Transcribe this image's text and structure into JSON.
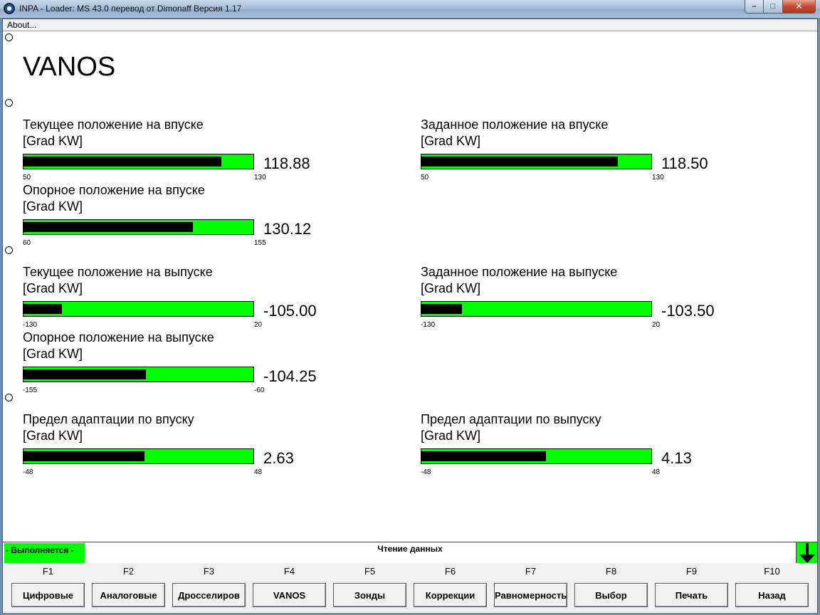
{
  "window": {
    "title": "INPA - Loader:  MS 43.0 перевод от Dimonaff Версия 1.17",
    "controls": {
      "minimize": "–",
      "maximize": "□",
      "close": "✕"
    }
  },
  "menu": {
    "about": "About..."
  },
  "screen": {
    "heading": "VANOS"
  },
  "gauges": [
    {
      "title": "Текущее положение на впуске",
      "unit": "[Grad KW]",
      "min": "50",
      "max": "130",
      "value": "118.88",
      "level": 0.861
    },
    {
      "title": "Заданное положение на впуске",
      "unit": "[Grad KW]",
      "min": "50",
      "max": "130",
      "value": "118.50",
      "level": 0.856
    },
    {
      "title": "Опорное положение на впуске",
      "unit": "[Grad KW]",
      "min": "60",
      "max": "155",
      "value": "130.12",
      "level": 0.738
    },
    {
      "title": "Текущее положение на выпуске",
      "unit": "[Grad KW]",
      "min": "-130",
      "max": "20",
      "value": "-105.00",
      "level": 0.167
    },
    {
      "title": "Заданное положение на выпуске",
      "unit": "[Grad KW]",
      "min": "-130",
      "max": "20",
      "value": "-103.50",
      "level": 0.177
    },
    {
      "title": "Опорное положение на выпуске",
      "unit": "[Grad KW]",
      "min": "-155",
      "max": "-60",
      "value": "-104.25",
      "level": 0.534
    },
    {
      "title": "Предел адаптации по впуску",
      "unit": "[Grad KW]",
      "min": "-48",
      "max": "48",
      "value": "2.63",
      "level": 0.527
    },
    {
      "title": "Предел адаптации по выпуску",
      "unit": "[Grad KW]",
      "min": "-48",
      "max": "48",
      "value": "4.13",
      "level": 0.543
    }
  ],
  "status": {
    "running": "- Выполняется -",
    "message": "Чтение данных"
  },
  "fkeys": [
    {
      "key": "F1",
      "label": "Цифровые"
    },
    {
      "key": "F2",
      "label": "Аналоговые"
    },
    {
      "key": "F3",
      "label": "Дросселиров"
    },
    {
      "key": "F4",
      "label": "VANOS"
    },
    {
      "key": "F5",
      "label": "Зонды"
    },
    {
      "key": "F6",
      "label": "Коррекции"
    },
    {
      "key": "F7",
      "label": "Равномерность"
    },
    {
      "key": "F8",
      "label": "Выбор"
    },
    {
      "key": "F9",
      "label": "Печать"
    },
    {
      "key": "F10",
      "label": "Назад"
    }
  ],
  "colors": {
    "bar_bg": "#00ff00",
    "bar_fill": "#000000",
    "status_green": "#00ff00"
  }
}
